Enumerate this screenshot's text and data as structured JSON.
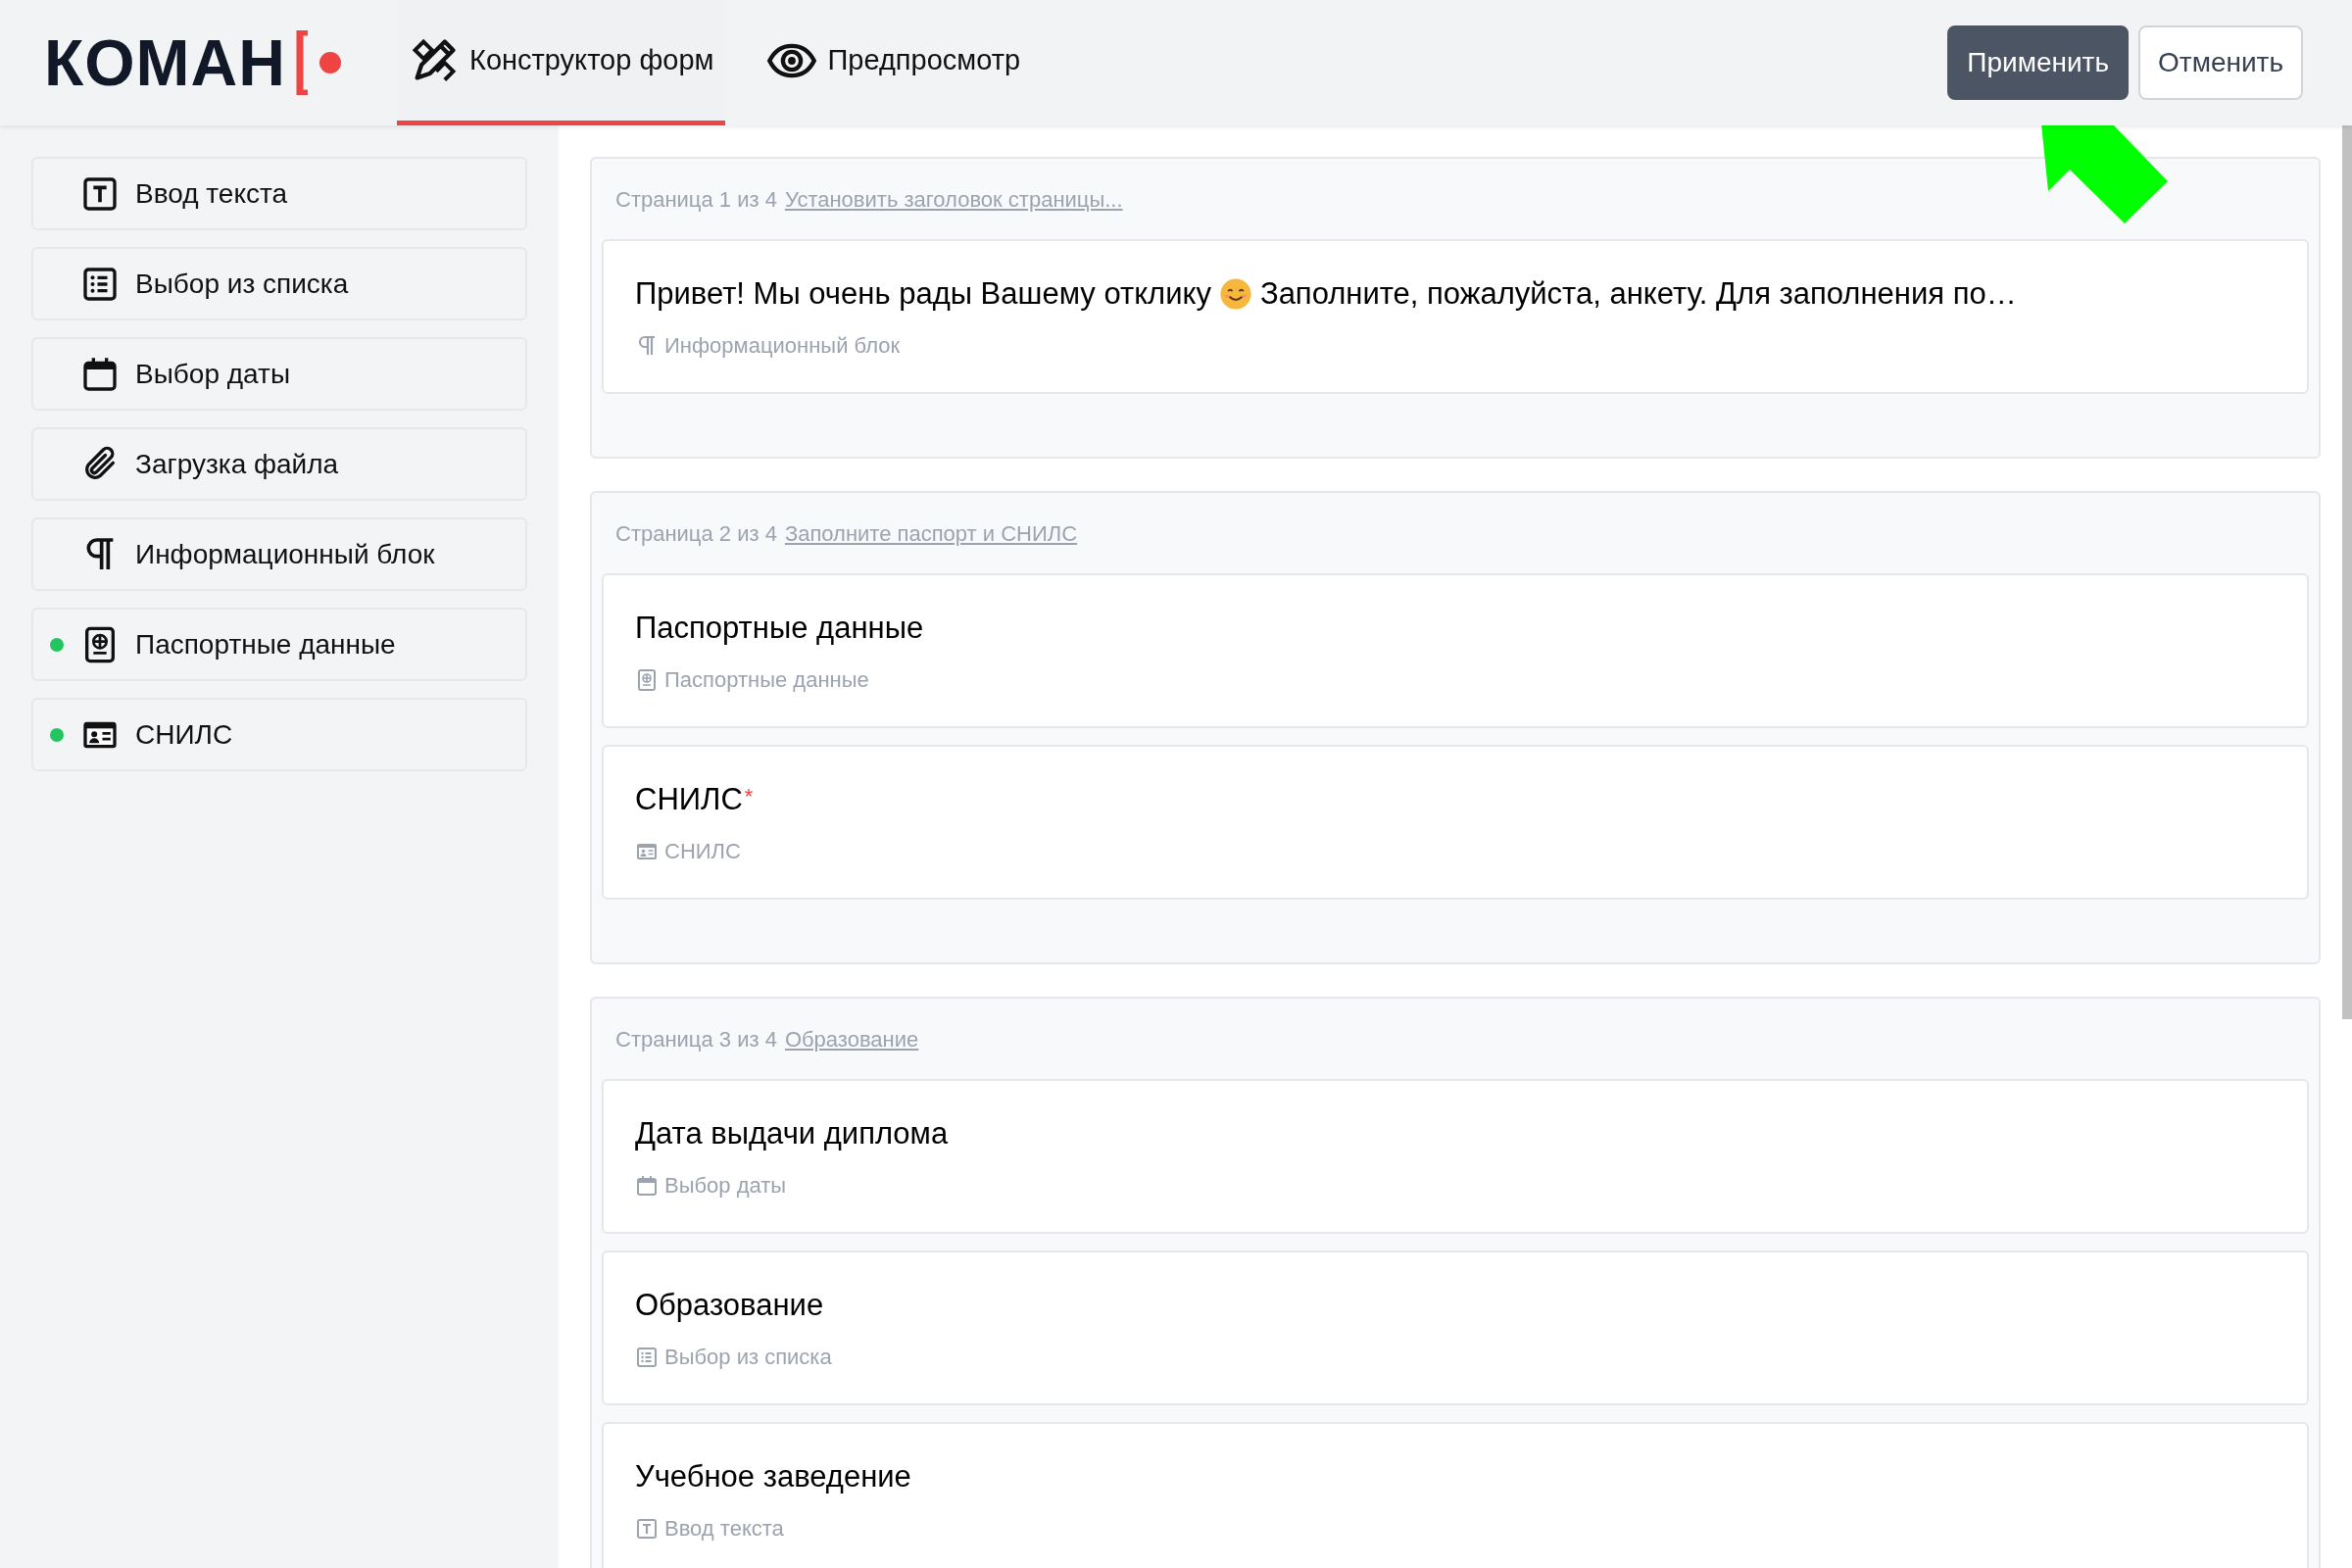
{
  "header": {
    "logo": "КОМАН",
    "tabs": [
      {
        "label": "Конструктор форм",
        "kind": "builder",
        "selected": true
      },
      {
        "label": "Предпросмотр",
        "kind": "preview",
        "selected": false
      }
    ],
    "buttons": [
      {
        "label": "Применить",
        "kind": "primary"
      },
      {
        "label": "Отменить",
        "kind": "secondary"
      }
    ]
  },
  "sidebar": {
    "items": [
      {
        "label": "Ввод текста",
        "kind": "text",
        "in_use": false
      },
      {
        "label": "Выбор из списка",
        "kind": "select",
        "in_use": false
      },
      {
        "label": "Выбор даты",
        "kind": "date",
        "in_use": false
      },
      {
        "label": "Загрузка файла",
        "kind": "file",
        "in_use": false
      },
      {
        "label": "Информационный блок",
        "kind": "info",
        "in_use": false
      },
      {
        "label": "Паспортные данные",
        "kind": "passport",
        "in_use": true
      },
      {
        "label": "СНИЛС",
        "kind": "snils",
        "in_use": true
      }
    ]
  },
  "pages": [
    {
      "counter": "Страница 1 из 4",
      "title_link": "Установить заголовок страницы...",
      "fields": [
        {
          "title": "Привет! Мы очень рады Вашему отклику",
          "emoji": true,
          "title_after": "Заполните, пожалуйста, анкету. Для заполнения по…",
          "type_label": "Информационный блок",
          "kind": "info"
        }
      ]
    },
    {
      "counter": "Страница 2 из 4",
      "title_link": "Заполните паспорт и СНИЛС",
      "fields": [
        {
          "title": "Паспортные данные",
          "type_label": "Паспортные данные",
          "kind": "passport"
        },
        {
          "title": "СНИЛС",
          "required_mark": "*",
          "type_label": "СНИЛС",
          "kind": "snils"
        }
      ]
    },
    {
      "counter": "Страница 3 из 4",
      "title_link": "Образование",
      "fields": [
        {
          "title": "Дата выдачи диплома",
          "type_label": "Выбор даты",
          "kind": "date"
        },
        {
          "title": "Образование",
          "type_label": "Выбор из списка",
          "kind": "select"
        },
        {
          "title": "Учебное заведение",
          "type_label": "Ввод текста",
          "kind": "text"
        }
      ]
    }
  ]
}
